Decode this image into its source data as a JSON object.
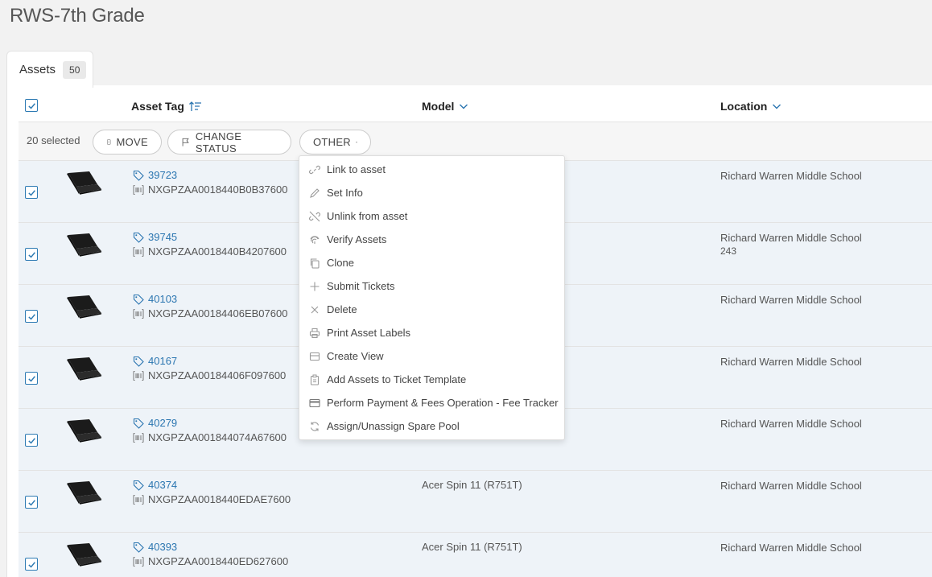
{
  "page": {
    "title": "RWS-7th Grade"
  },
  "tabs": [
    {
      "label": "Assets",
      "count": "50"
    }
  ],
  "columns": {
    "asset_tag": "Asset Tag",
    "model": "Model",
    "location": "Location"
  },
  "action_bar": {
    "selected": "20 selected",
    "move": "MOVE",
    "change_status": "CHANGE STATUS",
    "other": "OTHER"
  },
  "menu": [
    {
      "label": "Link to asset",
      "icon": "link-icon"
    },
    {
      "label": "Set Info",
      "icon": "pencil-icon"
    },
    {
      "label": "Unlink from asset",
      "icon": "unlink-icon"
    },
    {
      "label": "Verify Assets",
      "icon": "fingerprint-icon"
    },
    {
      "label": "Clone",
      "icon": "copy-icon"
    },
    {
      "label": "Submit Tickets",
      "icon": "plus-icon"
    },
    {
      "label": "Delete",
      "icon": "close-icon"
    },
    {
      "label": "Print Asset Labels",
      "icon": "printer-icon"
    },
    {
      "label": "Create View",
      "icon": "view-icon"
    },
    {
      "label": "Add Assets to Ticket Template",
      "icon": "clipboard-icon"
    },
    {
      "label": "Perform Payment & Fees Operation - Fee Tracker",
      "icon": "credit-card-icon"
    },
    {
      "label": "Assign/Unassign Spare Pool",
      "icon": "refresh-icon"
    }
  ],
  "rows": [
    {
      "tag": "39723",
      "serial": "NXGPZAA0018440B0B37600",
      "model": "",
      "location": "Richard Warren Middle School",
      "room": ""
    },
    {
      "tag": "39745",
      "serial": "NXGPZAA0018440B4207600",
      "model": "",
      "location": "Richard Warren Middle School",
      "room": "243"
    },
    {
      "tag": "40103",
      "serial": "NXGPZAA00184406EB07600",
      "model": "",
      "location": "Richard Warren Middle School",
      "room": ""
    },
    {
      "tag": "40167",
      "serial": "NXGPZAA00184406F097600",
      "model": "",
      "location": "Richard Warren Middle School",
      "room": ""
    },
    {
      "tag": "40279",
      "serial": "NXGPZAA001844074A67600",
      "model": "",
      "location": "Richard Warren Middle School",
      "room": ""
    },
    {
      "tag": "40374",
      "serial": "NXGPZAA0018440EDAE7600",
      "model": "Acer Spin 11 (R751T)",
      "location": "Richard Warren Middle School",
      "room": ""
    },
    {
      "tag": "40393",
      "serial": "NXGPZAA0018440ED627600",
      "model": "Acer Spin 11 (R751T)",
      "location": "Richard Warren Middle School",
      "room": ""
    }
  ],
  "colors": {
    "accent": "#2a75b0",
    "selected_row": "#eef3f8"
  }
}
